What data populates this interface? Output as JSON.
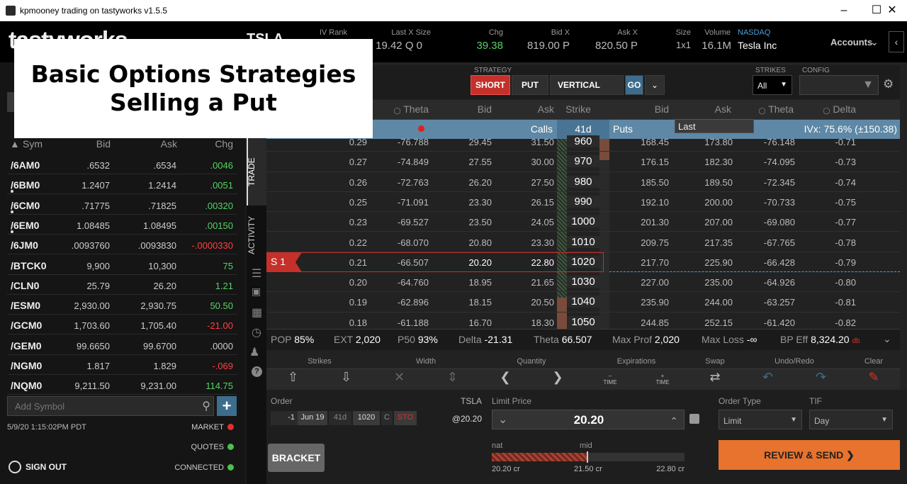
{
  "window": {
    "title": "kpmooney trading on tastyworks v1.5.5",
    "min_icon": "minimize-icon",
    "max_icon": "maximize-icon",
    "close_icon": "close-icon"
  },
  "logo": "tastyworks",
  "overlay": {
    "line1": "Basic Options Strategies",
    "line2": "Selling a Put"
  },
  "header": {
    "symbol": "TSLA",
    "iv_rank_label": "IV Rank",
    "last_x_size_label": "Last X Size",
    "last_x_size_value": "19.42 Q 0",
    "chg_label": "Chg",
    "chg_value": "39.38",
    "bid_x_label": "Bid X",
    "bid_x_value": "819.00 P",
    "ask_x_label": "Ask X",
    "ask_x_value": "820.50 P",
    "size_label": "Size",
    "size_value": "1x1",
    "volume_label": "Volume",
    "volume_value": "16.1M",
    "exchange": "NASDAQ",
    "company": "Tesla Inc",
    "accounts_label": "Accounts"
  },
  "watchlist": {
    "headers": {
      "sym": "Sym",
      "bid": "Bid",
      "ask": "Ask",
      "chg": "Chg"
    },
    "rows": [
      {
        "sym": "/6AM0",
        "bid": ".6532",
        "ask": ".6534",
        "chg": ".0046",
        "dir": "pos",
        "dot": false
      },
      {
        "sym": "/6BM0",
        "bid": "1.2407",
        "ask": "1.2414",
        "chg": ".0051",
        "dir": "pos",
        "dot": true
      },
      {
        "sym": "/6CM0",
        "bid": ".71775",
        "ask": ".71825",
        "chg": ".00320",
        "dir": "pos",
        "dot": true
      },
      {
        "sym": "/6EM0",
        "bid": "1.08485",
        "ask": "1.08495",
        "chg": ".00150",
        "dir": "pos",
        "dot": true
      },
      {
        "sym": "/6JM0",
        "bid": ".0093760",
        "ask": ".0093830",
        "chg": "-.0000330",
        "dir": "neg",
        "dot": false
      },
      {
        "sym": "/BTCK0",
        "bid": "9,900",
        "ask": "10,300",
        "chg": "75",
        "dir": "pos",
        "dot": false
      },
      {
        "sym": "/CLN0",
        "bid": "25.79",
        "ask": "26.20",
        "chg": "1.21",
        "dir": "pos",
        "dot": false
      },
      {
        "sym": "/ESM0",
        "bid": "2,930.00",
        "ask": "2,930.75",
        "chg": "50.50",
        "dir": "pos",
        "dot": false
      },
      {
        "sym": "/GCM0",
        "bid": "1,703.60",
        "ask": "1,705.40",
        "chg": "-21.00",
        "dir": "neg",
        "dot": false
      },
      {
        "sym": "/GEM0",
        "bid": "99.6650",
        "ask": "99.6700",
        "chg": ".0000",
        "dir": "neu",
        "dot": false
      },
      {
        "sym": "/NGM0",
        "bid": "1.817",
        "ask": "1.829",
        "chg": "-.069",
        "dir": "neg",
        "dot": false
      },
      {
        "sym": "/NQM0",
        "bid": "9,211.50",
        "ask": "9,231.00",
        "chg": "114.75",
        "dir": "pos",
        "dot": false
      }
    ],
    "add_symbol_placeholder": "Add Symbol",
    "timestamp": "5/9/20 1:15:02PM PDT",
    "market_label": "MARKET",
    "quotes_label": "QUOTES",
    "connected_label": "CONNECTED",
    "sign_out": "SIGN OUT"
  },
  "vtabs": {
    "trade": "TRADE",
    "activity": "ACTIVITY"
  },
  "strategy": {
    "label": "STRATEGY",
    "short": "SHORT",
    "put": "PUT",
    "vertical": "VERTICAL",
    "go": "GO",
    "strikes_label": "STRIKES",
    "strikes_value": "All",
    "config_label": "CONFIG"
  },
  "chain": {
    "headers": {
      "theta_l": "Theta",
      "bid_l": "Bid",
      "ask_l": "Ask",
      "strike": "Strike",
      "bid_r": "Bid",
      "ask_r": "Ask",
      "theta_r": "Theta",
      "delta_r": "Delta"
    },
    "calls_label": "Calls",
    "days": "41d",
    "puts_label": "Puts",
    "last_label": "Last",
    "ivx": "IVx: 75.6% (±150.38)",
    "position_label": "S 1",
    "rows": [
      {
        "d": "0.29",
        "th": "-76.788",
        "bid": "29.45",
        "ask": "31.50",
        "strike": "960",
        "pbid": "168.45",
        "pask": "173.80",
        "pth": "-76.148",
        "pd": "-0.71"
      },
      {
        "d": "0.27",
        "th": "-74.849",
        "bid": "27.55",
        "ask": "30.00",
        "strike": "970",
        "pbid": "176.15",
        "pask": "182.30",
        "pth": "-74.095",
        "pd": "-0.73"
      },
      {
        "d": "0.26",
        "th": "-72.763",
        "bid": "26.20",
        "ask": "27.50",
        "strike": "980",
        "pbid": "185.50",
        "pask": "189.50",
        "pth": "-72.345",
        "pd": "-0.74"
      },
      {
        "d": "0.25",
        "th": "-71.091",
        "bid": "23.30",
        "ask": "26.15",
        "strike": "990",
        "pbid": "192.10",
        "pask": "200.00",
        "pth": "-70.733",
        "pd": "-0.75"
      },
      {
        "d": "0.23",
        "th": "-69.527",
        "bid": "23.50",
        "ask": "24.05",
        "strike": "1000",
        "pbid": "201.30",
        "pask": "207.00",
        "pth": "-69.080",
        "pd": "-0.77"
      },
      {
        "d": "0.22",
        "th": "-68.070",
        "bid": "20.80",
        "ask": "23.30",
        "strike": "1010",
        "pbid": "209.75",
        "pask": "217.35",
        "pth": "-67.765",
        "pd": "-0.78"
      },
      {
        "d": "0.21",
        "th": "-66.507",
        "bid": "20.20",
        "ask": "22.80",
        "strike": "1020",
        "pbid": "217.70",
        "pask": "225.90",
        "pth": "-66.428",
        "pd": "-0.79"
      },
      {
        "d": "0.20",
        "th": "-64.760",
        "bid": "18.95",
        "ask": "21.65",
        "strike": "1030",
        "pbid": "227.00",
        "pask": "235.00",
        "pth": "-64.926",
        "pd": "-0.80"
      },
      {
        "d": "0.19",
        "th": "-62.896",
        "bid": "18.15",
        "ask": "20.50",
        "strike": "1040",
        "pbid": "235.90",
        "pask": "244.00",
        "pth": "-63.257",
        "pd": "-0.81"
      },
      {
        "d": "0.18",
        "th": "-61.188",
        "bid": "16.70",
        "ask": "18.30",
        "strike": "1050",
        "pbid": "244.85",
        "pask": "252.15",
        "pth": "-61.420",
        "pd": "-0.82"
      }
    ]
  },
  "stats": {
    "pop_k": "POP",
    "pop_v": "85%",
    "ext_k": "EXT",
    "ext_v": "2,020",
    "p50_k": "P50",
    "p50_v": "93%",
    "delta_k": "Delta",
    "delta_v": "-21.31",
    "theta_k": "Theta",
    "theta_v": "66.507",
    "maxprof_k": "Max Prof",
    "maxprof_v": "2,020",
    "maxloss_k": "Max Loss",
    "maxloss_v": "-∞",
    "bpeff_k": "BP Eff",
    "bpeff_v": "8,324.20",
    "bpeff_unit": "db"
  },
  "toolbar": {
    "strikes": "Strikes",
    "width": "Width",
    "quantity": "Quantity",
    "expirations": "Expirations",
    "swap": "Swap",
    "undoredo": "Undo/Redo",
    "clear": "Clear",
    "time_left": "TIME",
    "time_right": "TIME"
  },
  "order": {
    "order_label": "Order",
    "qty": "-1",
    "exp": "Jun 19",
    "days": "41d",
    "strike": "1020",
    "type": "C",
    "action": "STO",
    "symbol": "TSLA",
    "at_price": "@20.20",
    "limit_label": "Limit Price",
    "limit_value": "20.20",
    "order_type_label": "Order Type",
    "order_type_value": "Limit",
    "tif_label": "TIF",
    "tif_value": "Day",
    "bracket": "BRACKET",
    "nat_label": "nat",
    "mid_label": "mid",
    "nat_value": "20.20 cr",
    "mid_value": "21.50 cr",
    "far_value": "22.80 cr",
    "review_send": "REVIEW & SEND"
  },
  "colors": {
    "accent_red": "#d6342a",
    "go_blue": "#3d6d8c",
    "review_orange": "#e8732e",
    "positive": "#56d364",
    "negative": "#ff4040"
  }
}
